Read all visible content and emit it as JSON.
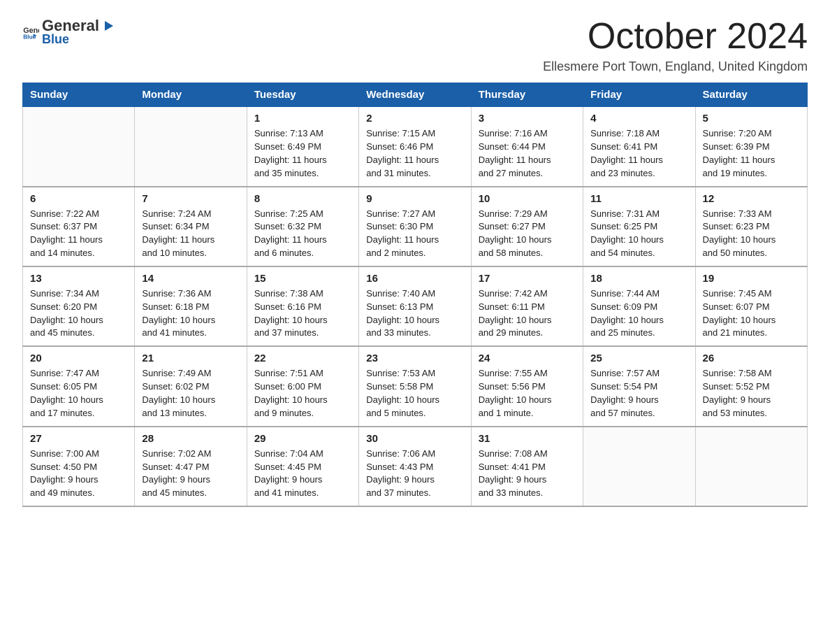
{
  "logo": {
    "general": "General",
    "arrow": "▶",
    "blue": "Blue"
  },
  "title": "October 2024",
  "subtitle": "Ellesmere Port Town, England, United Kingdom",
  "days_header": [
    "Sunday",
    "Monday",
    "Tuesday",
    "Wednesday",
    "Thursday",
    "Friday",
    "Saturday"
  ],
  "weeks": [
    [
      {
        "day": "",
        "info": ""
      },
      {
        "day": "",
        "info": ""
      },
      {
        "day": "1",
        "info": "Sunrise: 7:13 AM\nSunset: 6:49 PM\nDaylight: 11 hours\nand 35 minutes."
      },
      {
        "day": "2",
        "info": "Sunrise: 7:15 AM\nSunset: 6:46 PM\nDaylight: 11 hours\nand 31 minutes."
      },
      {
        "day": "3",
        "info": "Sunrise: 7:16 AM\nSunset: 6:44 PM\nDaylight: 11 hours\nand 27 minutes."
      },
      {
        "day": "4",
        "info": "Sunrise: 7:18 AM\nSunset: 6:41 PM\nDaylight: 11 hours\nand 23 minutes."
      },
      {
        "day": "5",
        "info": "Sunrise: 7:20 AM\nSunset: 6:39 PM\nDaylight: 11 hours\nand 19 minutes."
      }
    ],
    [
      {
        "day": "6",
        "info": "Sunrise: 7:22 AM\nSunset: 6:37 PM\nDaylight: 11 hours\nand 14 minutes."
      },
      {
        "day": "7",
        "info": "Sunrise: 7:24 AM\nSunset: 6:34 PM\nDaylight: 11 hours\nand 10 minutes."
      },
      {
        "day": "8",
        "info": "Sunrise: 7:25 AM\nSunset: 6:32 PM\nDaylight: 11 hours\nand 6 minutes."
      },
      {
        "day": "9",
        "info": "Sunrise: 7:27 AM\nSunset: 6:30 PM\nDaylight: 11 hours\nand 2 minutes."
      },
      {
        "day": "10",
        "info": "Sunrise: 7:29 AM\nSunset: 6:27 PM\nDaylight: 10 hours\nand 58 minutes."
      },
      {
        "day": "11",
        "info": "Sunrise: 7:31 AM\nSunset: 6:25 PM\nDaylight: 10 hours\nand 54 minutes."
      },
      {
        "day": "12",
        "info": "Sunrise: 7:33 AM\nSunset: 6:23 PM\nDaylight: 10 hours\nand 50 minutes."
      }
    ],
    [
      {
        "day": "13",
        "info": "Sunrise: 7:34 AM\nSunset: 6:20 PM\nDaylight: 10 hours\nand 45 minutes."
      },
      {
        "day": "14",
        "info": "Sunrise: 7:36 AM\nSunset: 6:18 PM\nDaylight: 10 hours\nand 41 minutes."
      },
      {
        "day": "15",
        "info": "Sunrise: 7:38 AM\nSunset: 6:16 PM\nDaylight: 10 hours\nand 37 minutes."
      },
      {
        "day": "16",
        "info": "Sunrise: 7:40 AM\nSunset: 6:13 PM\nDaylight: 10 hours\nand 33 minutes."
      },
      {
        "day": "17",
        "info": "Sunrise: 7:42 AM\nSunset: 6:11 PM\nDaylight: 10 hours\nand 29 minutes."
      },
      {
        "day": "18",
        "info": "Sunrise: 7:44 AM\nSunset: 6:09 PM\nDaylight: 10 hours\nand 25 minutes."
      },
      {
        "day": "19",
        "info": "Sunrise: 7:45 AM\nSunset: 6:07 PM\nDaylight: 10 hours\nand 21 minutes."
      }
    ],
    [
      {
        "day": "20",
        "info": "Sunrise: 7:47 AM\nSunset: 6:05 PM\nDaylight: 10 hours\nand 17 minutes."
      },
      {
        "day": "21",
        "info": "Sunrise: 7:49 AM\nSunset: 6:02 PM\nDaylight: 10 hours\nand 13 minutes."
      },
      {
        "day": "22",
        "info": "Sunrise: 7:51 AM\nSunset: 6:00 PM\nDaylight: 10 hours\nand 9 minutes."
      },
      {
        "day": "23",
        "info": "Sunrise: 7:53 AM\nSunset: 5:58 PM\nDaylight: 10 hours\nand 5 minutes."
      },
      {
        "day": "24",
        "info": "Sunrise: 7:55 AM\nSunset: 5:56 PM\nDaylight: 10 hours\nand 1 minute."
      },
      {
        "day": "25",
        "info": "Sunrise: 7:57 AM\nSunset: 5:54 PM\nDaylight: 9 hours\nand 57 minutes."
      },
      {
        "day": "26",
        "info": "Sunrise: 7:58 AM\nSunset: 5:52 PM\nDaylight: 9 hours\nand 53 minutes."
      }
    ],
    [
      {
        "day": "27",
        "info": "Sunrise: 7:00 AM\nSunset: 4:50 PM\nDaylight: 9 hours\nand 49 minutes."
      },
      {
        "day": "28",
        "info": "Sunrise: 7:02 AM\nSunset: 4:47 PM\nDaylight: 9 hours\nand 45 minutes."
      },
      {
        "day": "29",
        "info": "Sunrise: 7:04 AM\nSunset: 4:45 PM\nDaylight: 9 hours\nand 41 minutes."
      },
      {
        "day": "30",
        "info": "Sunrise: 7:06 AM\nSunset: 4:43 PM\nDaylight: 9 hours\nand 37 minutes."
      },
      {
        "day": "31",
        "info": "Sunrise: 7:08 AM\nSunset: 4:41 PM\nDaylight: 9 hours\nand 33 minutes."
      },
      {
        "day": "",
        "info": ""
      },
      {
        "day": "",
        "info": ""
      }
    ]
  ]
}
